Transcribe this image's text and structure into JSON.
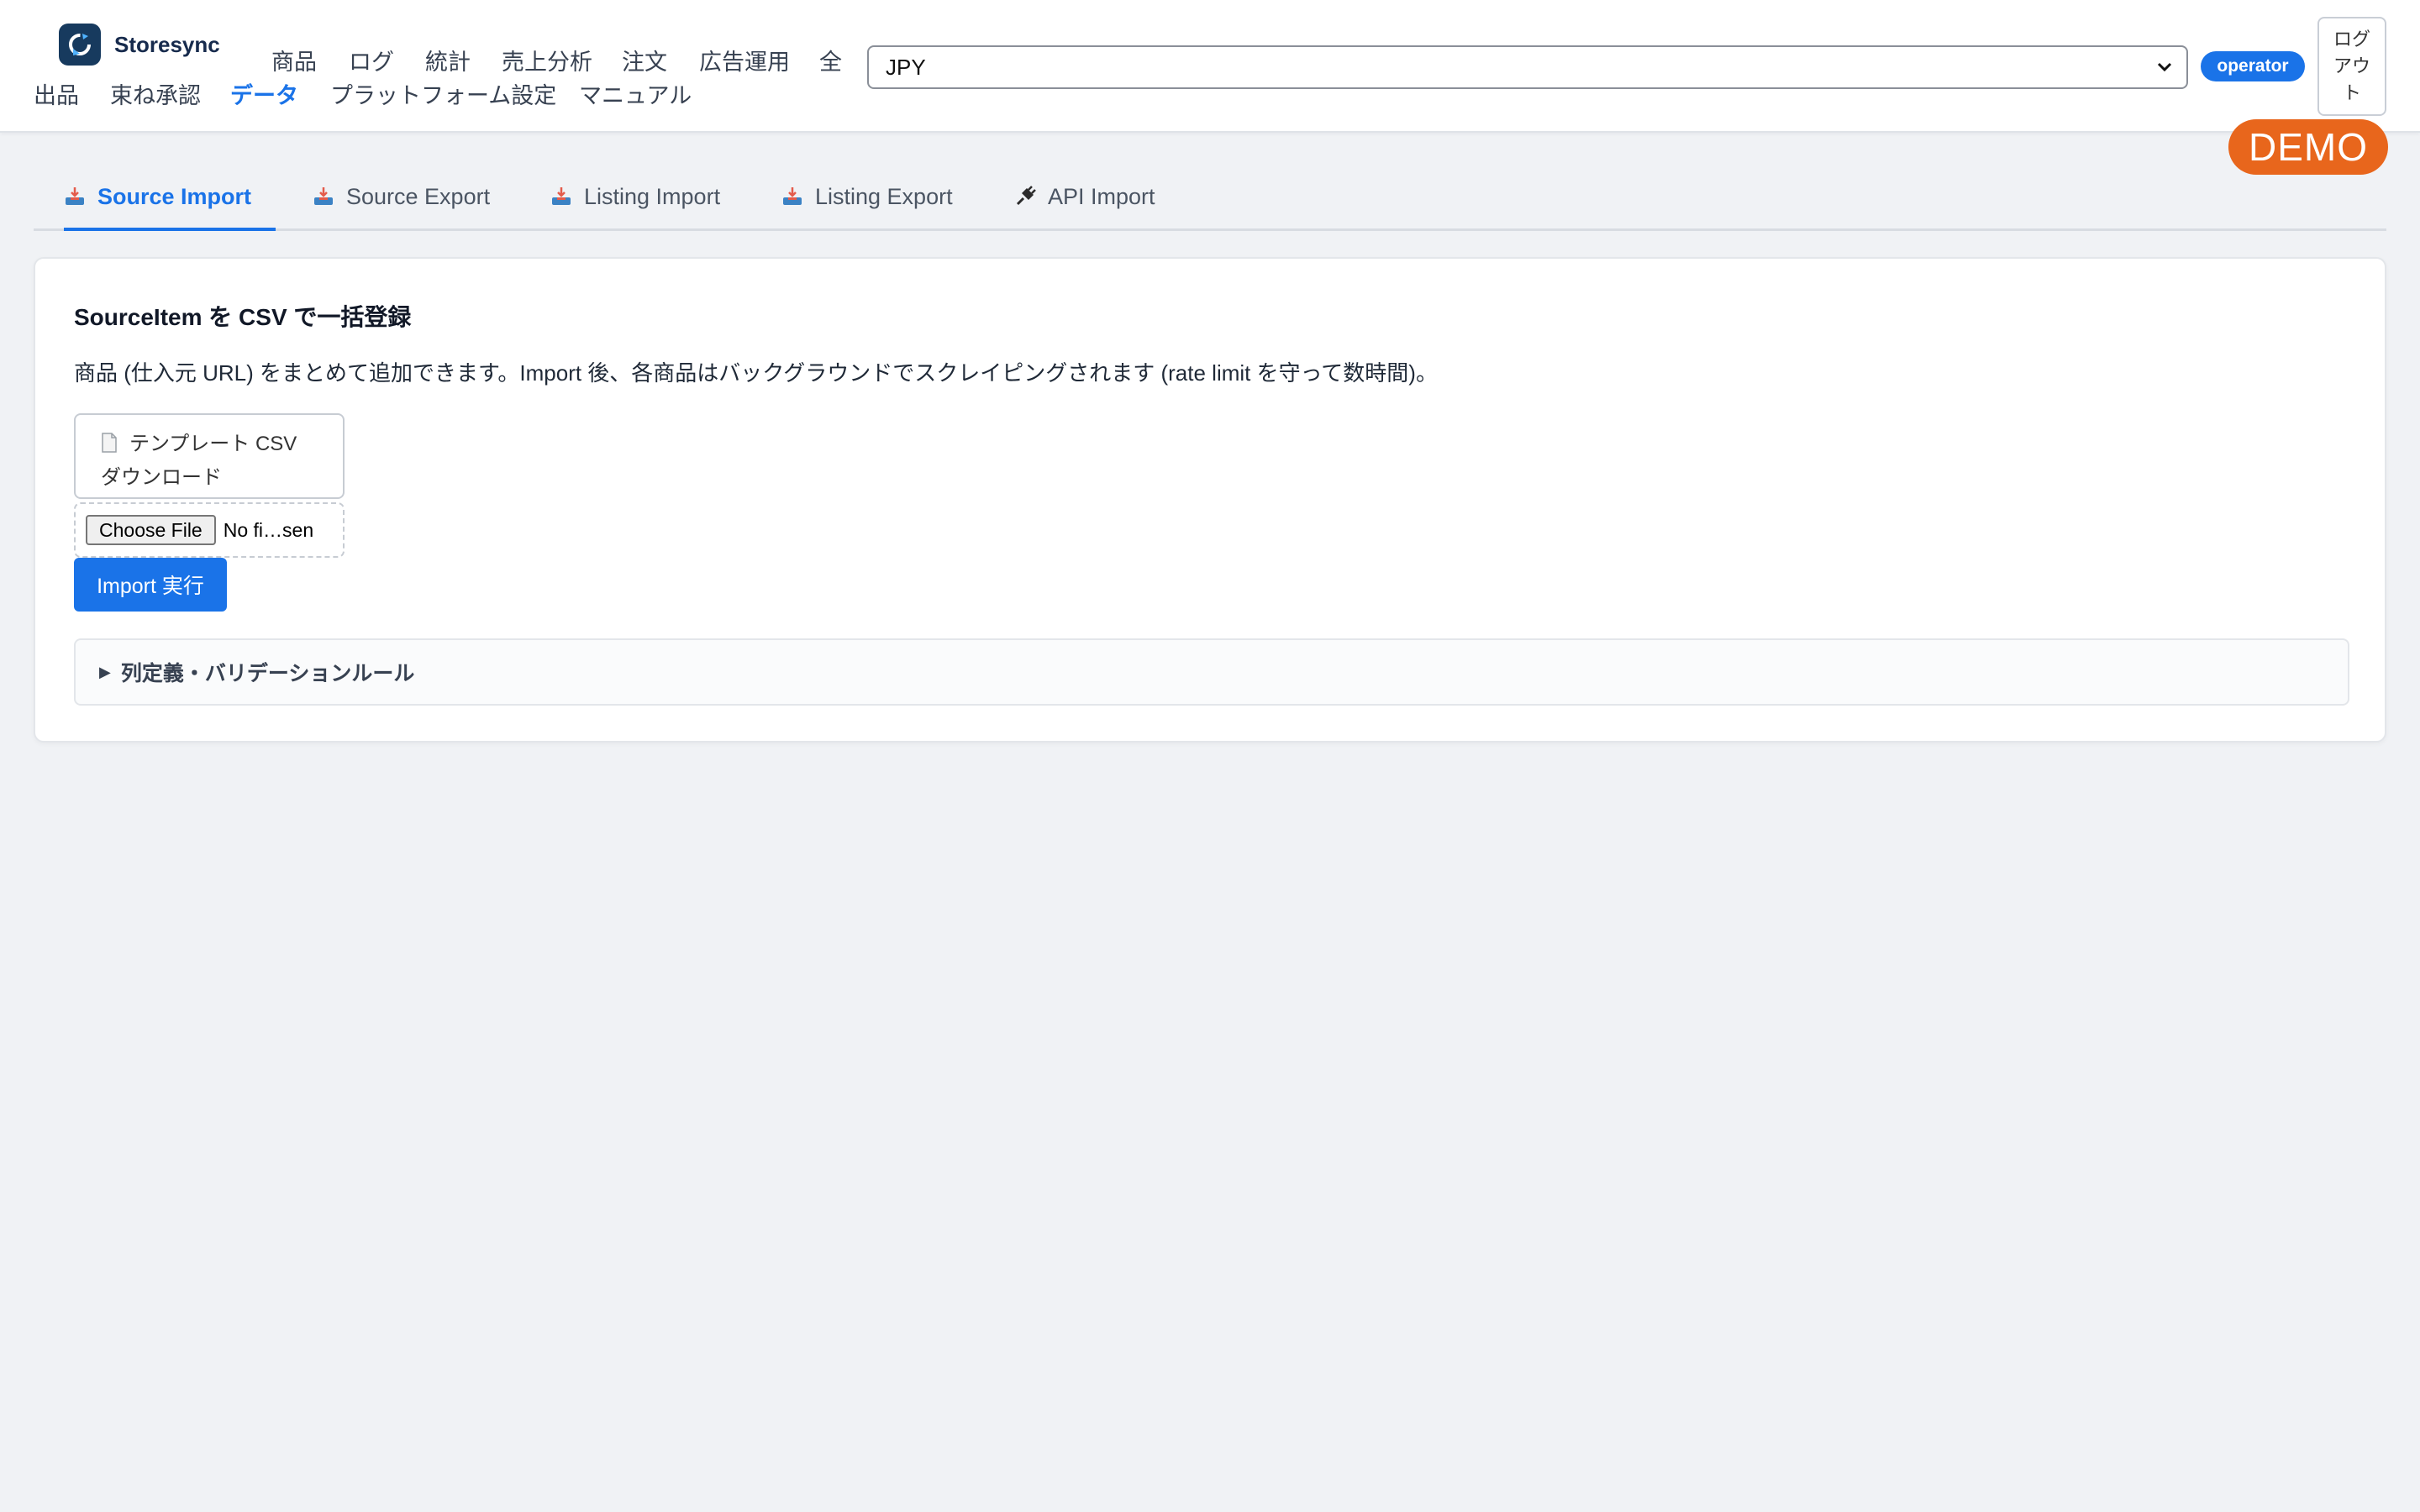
{
  "app": {
    "name": "Storesync"
  },
  "nav": {
    "row1": [
      "商品",
      "ログ",
      "統計",
      "売上分析",
      "注文",
      "広告運用",
      "全"
    ],
    "row2": [
      "出品",
      "束ね承認",
      "データ",
      "プラットフォーム設定",
      "マニュアル"
    ],
    "active": "データ"
  },
  "currency": {
    "selected": "JPY"
  },
  "user": {
    "role": "operator",
    "logout_label": "ログアウト"
  },
  "demo_label": "DEMO",
  "tabs": [
    {
      "label": "Source Import",
      "icon": "inbox-tray-icon",
      "active": true
    },
    {
      "label": "Source Export",
      "icon": "inbox-tray-icon",
      "active": false
    },
    {
      "label": "Listing Import",
      "icon": "inbox-tray-icon",
      "active": false
    },
    {
      "label": "Listing Export",
      "icon": "inbox-tray-icon",
      "active": false
    },
    {
      "label": "API Import",
      "icon": "plug-icon",
      "active": false
    }
  ],
  "card": {
    "title": "SourceItem を CSV で一括登録",
    "description": "商品 (仕入元 URL) をまとめて追加できます。Import 後、各商品はバックグラウンドでスクレイピングされます (rate limit を守って数時間)。",
    "template_line1": "テンプレート CSV",
    "template_line2": "ダウンロード",
    "choose_file_label": "Choose File",
    "no_file_label": "No fi…sen",
    "import_label": "Import 実行",
    "rules_label": "列定義・バリデーションルール"
  },
  "colors": {
    "accent": "#1a73e8",
    "demo": "#e8661c",
    "brand": "#173a5e"
  }
}
